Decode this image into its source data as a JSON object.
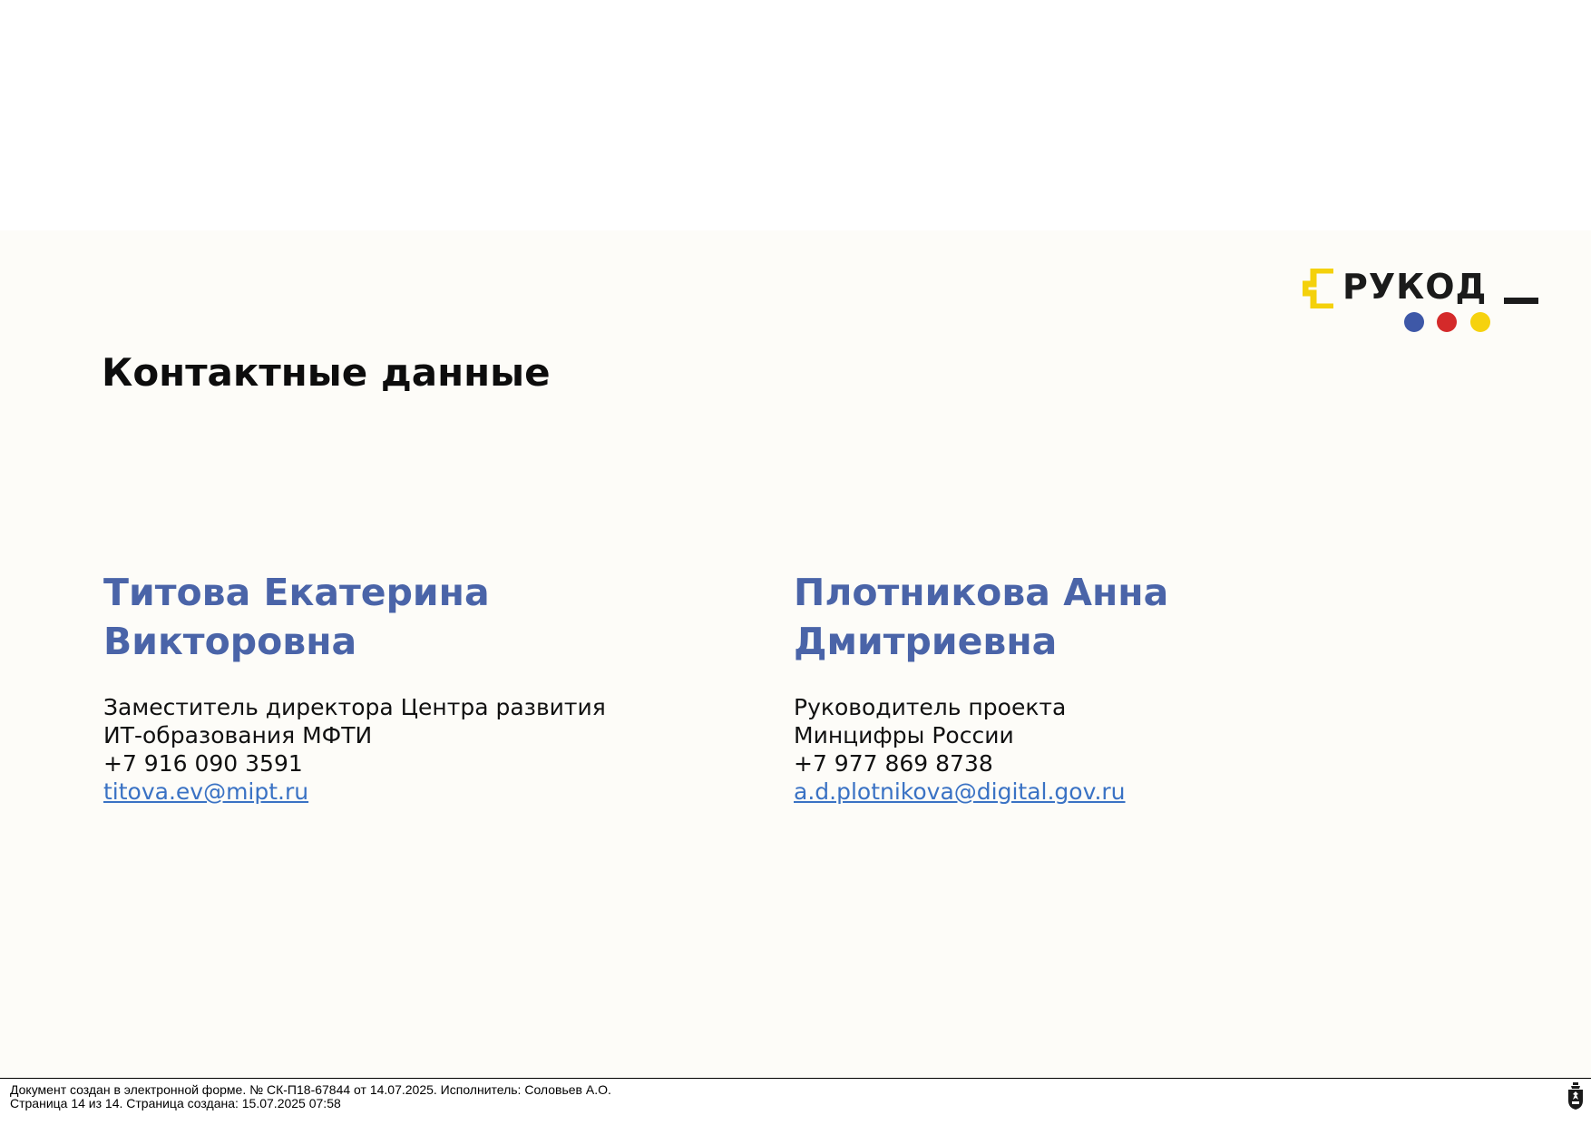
{
  "logo": {
    "text": "РУКОД",
    "colors": {
      "bracket": "#f4d10c",
      "text": "#1b1b1b",
      "dot_blue": "#3e58a7",
      "dot_red": "#d42a2a",
      "dot_yellow": "#f6d20e"
    }
  },
  "title": "Контактные данные",
  "contacts": [
    {
      "name_line1": "Титова Екатерина",
      "name_line2": "Викторовна",
      "role_line1": "Заместитель директора Центра развития",
      "role_line2": "ИТ-образования МФТИ",
      "phone": "+7 916 090 3591",
      "email": "titova.ev@mipt.ru"
    },
    {
      "name_line1": "Плотникова Анна",
      "name_line2": "Дмитриевна",
      "role_line1": "Руководитель проекта",
      "role_line2": "Минцифры России",
      "phone": "+7 977 869 8738",
      "email": "a.d.plotnikova@digital.gov.ru"
    }
  ],
  "footer": {
    "line1": "Документ создан в электронной форме. № СК-П18-67844 от 14.07.2025. Исполнитель: Соловьев А.О.",
    "line2": "Страница 14 из 14. Страница создана: 15.07.2025 07:58"
  },
  "colors": {
    "accent_name": "#4a64a8",
    "link": "#3a72c4",
    "slide_background": "#fdfcf8"
  }
}
